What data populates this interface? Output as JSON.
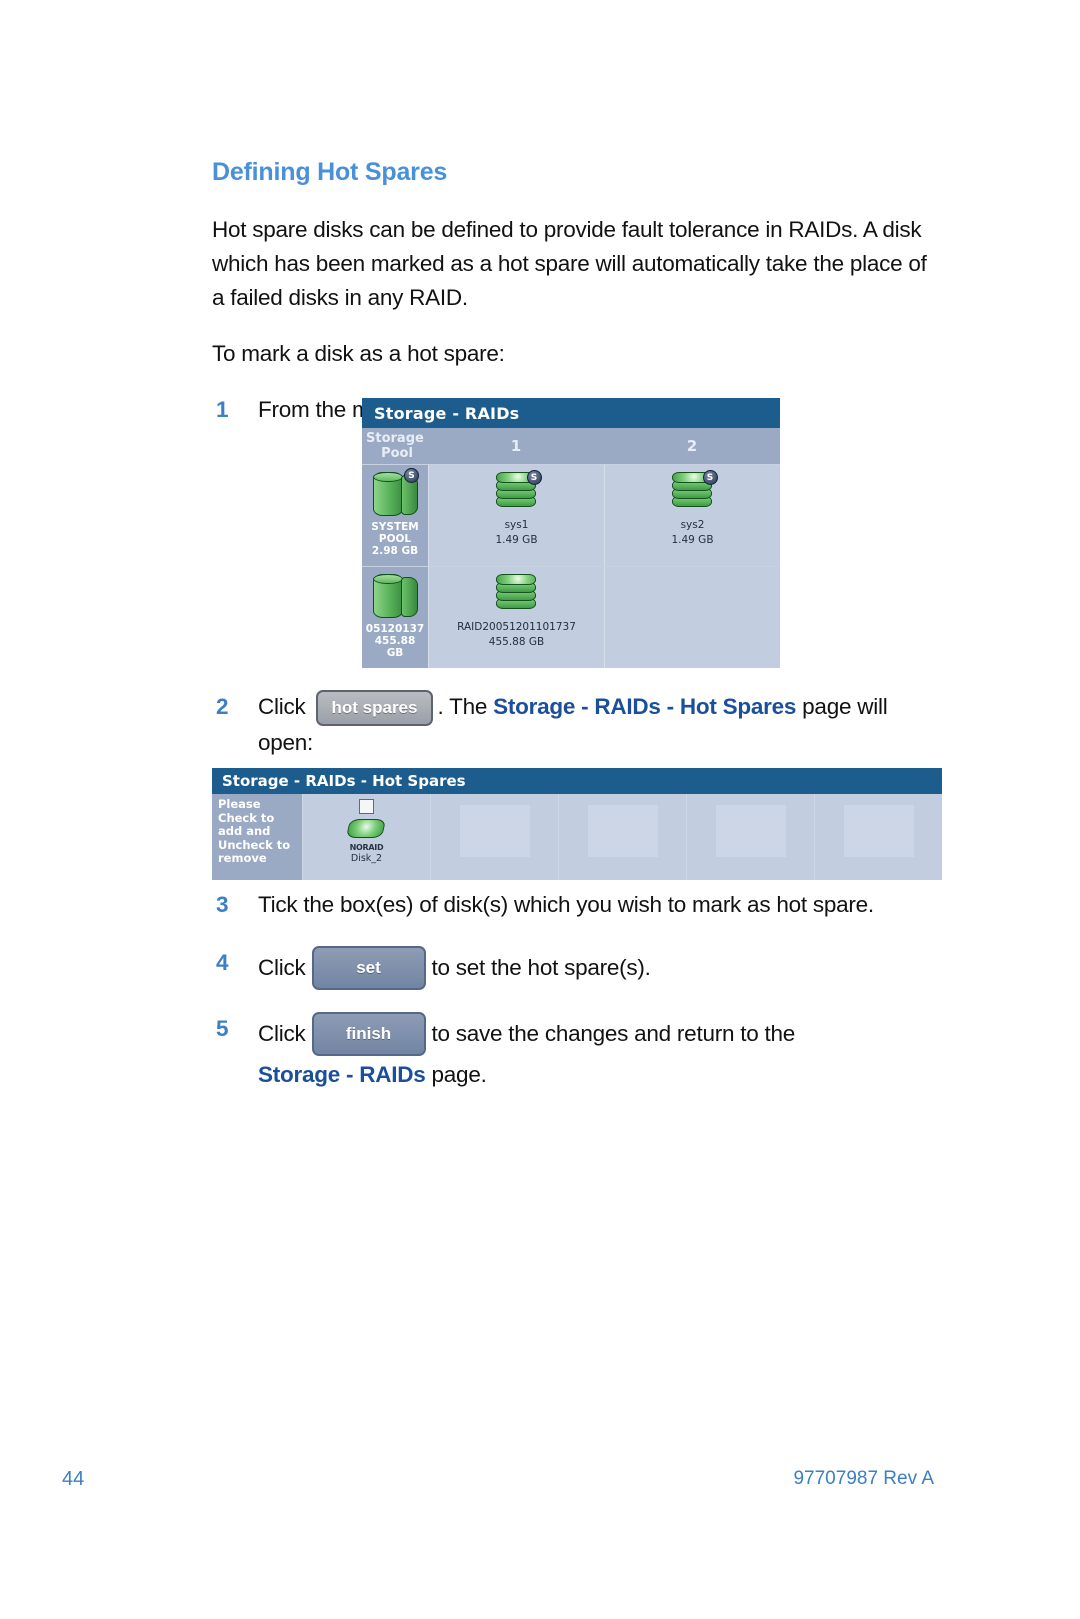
{
  "document": {
    "section_title": "Defining Hot Spares",
    "intro_paragraph": "Hot spare disks can be defined to provide fault tolerance in RAIDs. A disk which has been marked as a hot spare will automatically take the place of a failed disks in any RAID.",
    "lead_in": "To mark a disk as a hot spare:"
  },
  "steps": {
    "s1": {
      "num": "1",
      "text_before": "From the menu bar, select ",
      "bold": "Storage - RAIDs",
      "text_after": "."
    },
    "s2": {
      "num": "2",
      "text_before": "Click ",
      "button_label": "hot spares",
      "text_mid": ". The ",
      "bold": "Storage - RAIDs - Hot Spares",
      "text_after": " page will open:"
    },
    "s3": {
      "num": "3",
      "text": "Tick the box(es) of disk(s) which you wish to mark as hot spare."
    },
    "s4": {
      "num": "4",
      "text_before": "Click ",
      "button_label": "set",
      "text_after": "to set the hot spare(s)."
    },
    "s5": {
      "num": "5",
      "text_before": "Click ",
      "button_label": "finish",
      "text_after": "to save the changes and return to the ",
      "bold": "Storage - RAIDs",
      "text_end": " page."
    }
  },
  "screenshot_raids": {
    "title": "Storage - RAIDs",
    "column_headers": {
      "pool": "Storage\nPool",
      "pool_line1": "Storage",
      "pool_line2": "Pool",
      "col1": "1",
      "col2": "2"
    },
    "rows": [
      {
        "pool": {
          "line1": "SYSTEM",
          "line2": "POOL",
          "line3": "2.98 GB",
          "icon": "pool-cylinder-icon"
        },
        "cells": [
          {
            "name": "sys1",
            "size": "1.49 GB",
            "icon": "raid-stack-icon",
            "badge": "S"
          },
          {
            "name": "sys2",
            "size": "1.49 GB",
            "icon": "raid-stack-icon",
            "badge": "S"
          }
        ]
      },
      {
        "pool": {
          "line1": "05120137",
          "line2": "455.88",
          "line3": "GB",
          "icon": "pool-cylinder-icon"
        },
        "cells": [
          {
            "name": "RAID20051201101737",
            "size": "455.88 GB",
            "icon": "raid-stack-icon",
            "badge": ""
          },
          {
            "name": "",
            "size": "",
            "icon": "",
            "badge": ""
          }
        ]
      }
    ]
  },
  "screenshot_hotspares": {
    "title": "Storage - RAIDs - Hot Spares",
    "sidebar_lines": [
      "Please",
      "Check to",
      "add and",
      "Uncheck to",
      "remove"
    ],
    "disk": {
      "status": "NORAID",
      "name": "Disk_2",
      "checked": false
    },
    "empty_slots": 4
  },
  "footer": {
    "page_number": "44",
    "document_id": "97707987 Rev A"
  },
  "colors": {
    "heading_blue": "#4a90d9",
    "bold_blue": "#1b4f9c",
    "step_number_blue": "#3b7fc4",
    "titlebar_blue": "#1c5d8e",
    "panel_blue": "#c2cee0",
    "panel_side_blue": "#9aaac4"
  }
}
